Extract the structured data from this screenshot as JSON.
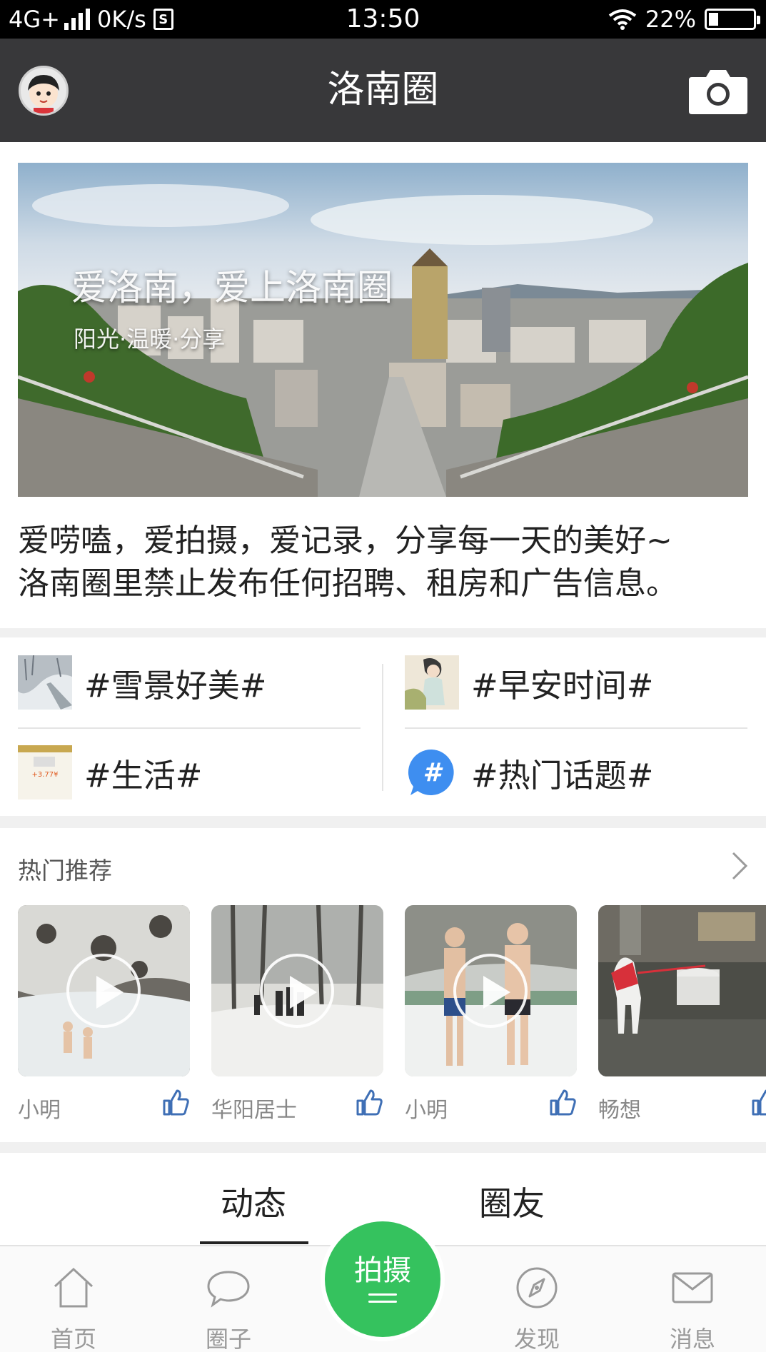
{
  "status_bar": {
    "network": "4G+",
    "speed": "0K/s",
    "sim_label": "S",
    "time": "13:50",
    "battery_text": "22%",
    "battery_level": 0.22
  },
  "header": {
    "title": "洛南圈",
    "avatar_icon": "avatar-icon",
    "camera_icon": "camera-icon"
  },
  "banner": {
    "title": "爱洛南，爱上洛南圈",
    "subtitle": "阳光·温暖·分享"
  },
  "description": {
    "line1": "爱唠嗑，爱拍摄，爱记录，分享每一天的美好~",
    "line2": "洛南圈里禁止发布任何招聘、租房和广告信息。"
  },
  "topics": [
    {
      "label": "#雪景好美#"
    },
    {
      "label": "#早安时间#"
    },
    {
      "label": "#生活#",
      "thumb_text": "+3.77¥"
    },
    {
      "label": "#热门话题#",
      "icon_text": "#"
    }
  ],
  "hot": {
    "title": "热门推荐",
    "items": [
      {
        "author": "小明",
        "is_video": true
      },
      {
        "author": "华阳居士",
        "is_video": true
      },
      {
        "author": "小明",
        "is_video": true
      },
      {
        "author": "畅想",
        "is_video": false
      }
    ]
  },
  "tabs": [
    {
      "label": "动态",
      "active": true
    },
    {
      "label": "圈友",
      "active": false
    }
  ],
  "bottom_nav": {
    "items": [
      {
        "label": "首页",
        "icon": "home-icon"
      },
      {
        "label": "圈子",
        "icon": "chat-bubble-icon"
      },
      {
        "label": "发现",
        "icon": "compass-icon"
      },
      {
        "label": "消息",
        "icon": "envelope-icon"
      }
    ],
    "center_label": "拍摄"
  },
  "colors": {
    "header_bg": "#38383a",
    "accent_green": "#35c25e",
    "like_blue": "#3f6fb5",
    "topic_icon_blue": "#3e8ef0"
  }
}
